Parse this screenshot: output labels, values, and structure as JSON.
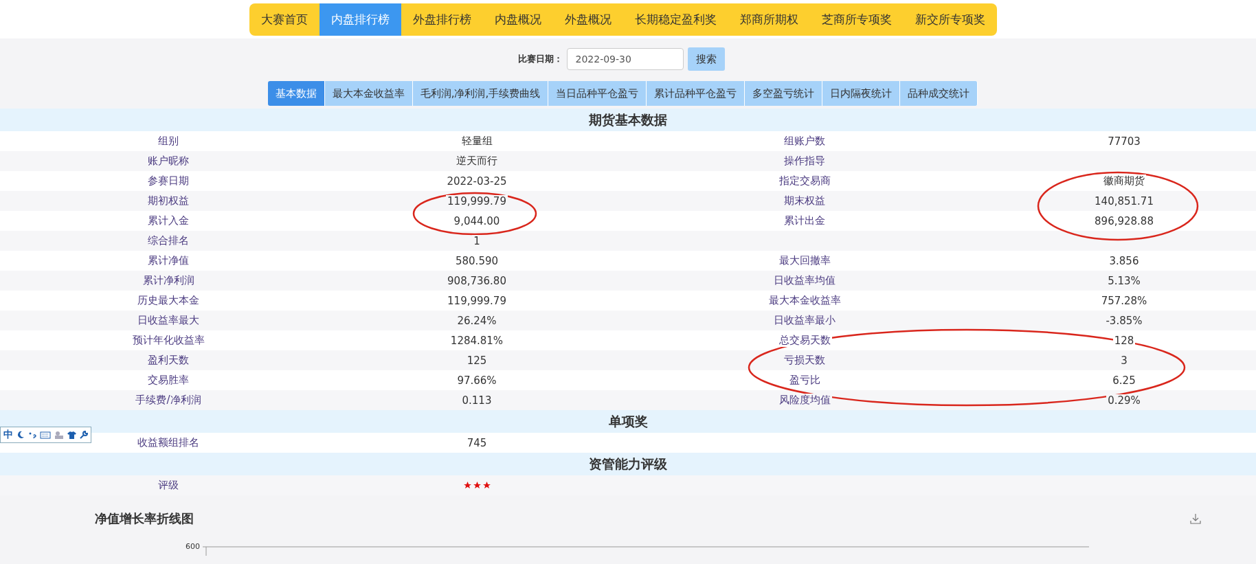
{
  "nav": [
    {
      "label": "大赛首页",
      "selected": false
    },
    {
      "label": "内盘排行榜",
      "selected": true
    },
    {
      "label": "外盘排行榜",
      "selected": false
    },
    {
      "label": "内盘概况",
      "selected": false
    },
    {
      "label": "外盘概况",
      "selected": false
    },
    {
      "label": "长期稳定盈利奖",
      "selected": false
    },
    {
      "label": "郑商所期权",
      "selected": false
    },
    {
      "label": "芝商所专项奖",
      "selected": false
    },
    {
      "label": "新交所专项奖",
      "selected": false
    }
  ],
  "date_filter": {
    "label": "比赛日期：",
    "value": "2022-09-30",
    "button": "搜索"
  },
  "sub_tabs": [
    {
      "label": "基本数据",
      "selected": true
    },
    {
      "label": "最大本金收益率",
      "selected": false
    },
    {
      "label": "毛利润,净利润,手续费曲线",
      "selected": false
    },
    {
      "label": "当日品种平仓盈亏",
      "selected": false
    },
    {
      "label": "累计品种平仓盈亏",
      "selected": false
    },
    {
      "label": "多空盈亏统计",
      "selected": false
    },
    {
      "label": "日内隔夜统计",
      "selected": false
    },
    {
      "label": "品种成交统计",
      "selected": false
    }
  ],
  "sections": [
    {
      "title": "期货基本数据",
      "rows": [
        {
          "label": "组别",
          "value": "轻量组",
          "label2": "组账户数",
          "value2": "77703"
        },
        {
          "label": "账户昵称",
          "value": "逆天而行",
          "label2": "操作指导"
        },
        {
          "label": "参赛日期",
          "value": "2022-03-25",
          "label2": "指定交易商",
          "value2": "徽商期货"
        },
        {
          "label": "期初权益",
          "value": "119,999.79",
          "label2": "期末权益",
          "value2": "140,851.71"
        },
        {
          "label": "累计入金",
          "value": "9,044.00",
          "label2": "累计出金",
          "value2": "896,928.88"
        },
        {
          "label": "综合排名",
          "value": "1"
        },
        {
          "label": "累计净值",
          "value": "580.590",
          "label2": "最大回撤率",
          "value2": "3.856"
        },
        {
          "label": "累计净利润",
          "value": "908,736.80",
          "label2": "日收益率均值",
          "value2": "5.13%"
        },
        {
          "label": "历史最大本金",
          "value": "119,999.79",
          "label2": "最大本金收益率",
          "value2": "757.28%"
        },
        {
          "label": "日收益率最大",
          "value": "26.24%",
          "label2": "日收益率最小",
          "value2": "-3.85%"
        },
        {
          "label": "预计年化收益率",
          "value": "1284.81%",
          "label2": "总交易天数",
          "value2": "128"
        },
        {
          "label": "盈利天数",
          "value": "125",
          "label2": "亏损天数",
          "value2": "3"
        },
        {
          "label": "交易胜率",
          "value": "97.66%",
          "label2": "盈亏比",
          "value2": "6.25"
        },
        {
          "label": "手续费/净利润",
          "value": "0.113",
          "label2": "风险度均值",
          "value2": "0.29%"
        }
      ]
    },
    {
      "title": "单项奖",
      "rows": [
        {
          "label": "收益额组排名",
          "value": "745"
        }
      ]
    },
    {
      "title": "资管能力评级",
      "rows": [
        {
          "label": "评级",
          "stars": 3
        }
      ]
    }
  ],
  "ime_toolbar": {
    "label": "中"
  },
  "chart": {
    "title": "净值增长率折线图",
    "y_tick": "600"
  }
}
